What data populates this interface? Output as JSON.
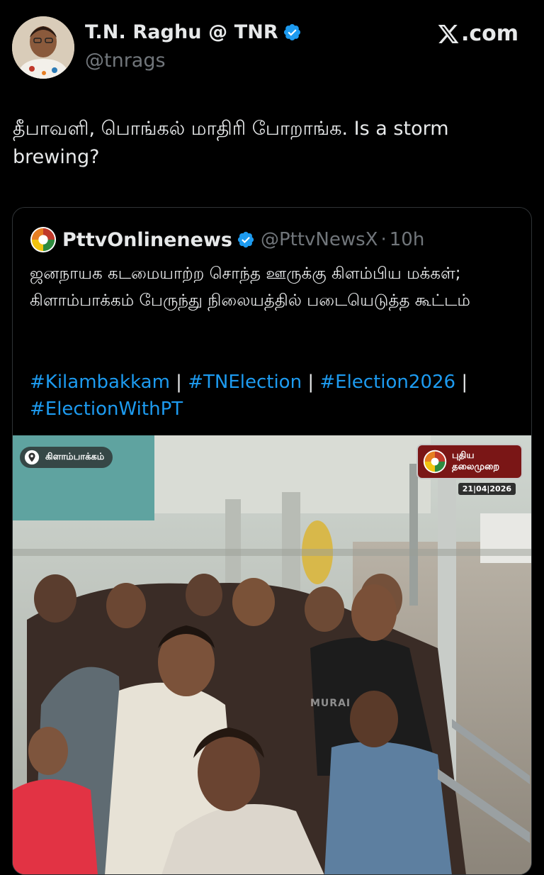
{
  "author": {
    "display_name": "T.N. Raghu @ TNR",
    "handle": "@tnrags",
    "avatar_icon": "avatar-photo",
    "verified_icon": "verified-badge-icon"
  },
  "brand": {
    "label": ".com",
    "icon": "x-logo-icon"
  },
  "tweet": {
    "text": "தீபாவளி, பொங்கல் மாதிரி போறாங்க. Is a storm brewing?"
  },
  "quote": {
    "author_name": "PttvOnlinenews",
    "handle": "@PttvNewsX",
    "dot": "·",
    "time": "10h",
    "body": "ஜனநாயக கடமையாற்ற சொந்த ஊருக்கு கிளம்பிய மக்கள்; கிளாம்பாக்கம் பேருந்து நிலையத்தில் படையெடுத்த கூட்டம்",
    "hashtags": [
      "#Kilambakkam",
      "#TNElection",
      "#Election2026",
      "#ElectionWithPT"
    ],
    "separator": "|"
  },
  "media": {
    "location_label": "கிளாம்பாக்கம்",
    "channel_name_line1": "புதிய",
    "channel_name_line2": "தலைமுறை",
    "date": "21|04|2026",
    "watermark": "MURAI"
  },
  "colors": {
    "background": "#000000",
    "text": "#e7e9ea",
    "secondary_text": "#71767b",
    "link": "#1d9bf0",
    "verified": "#1d9bf0",
    "border": "#2f3336"
  }
}
